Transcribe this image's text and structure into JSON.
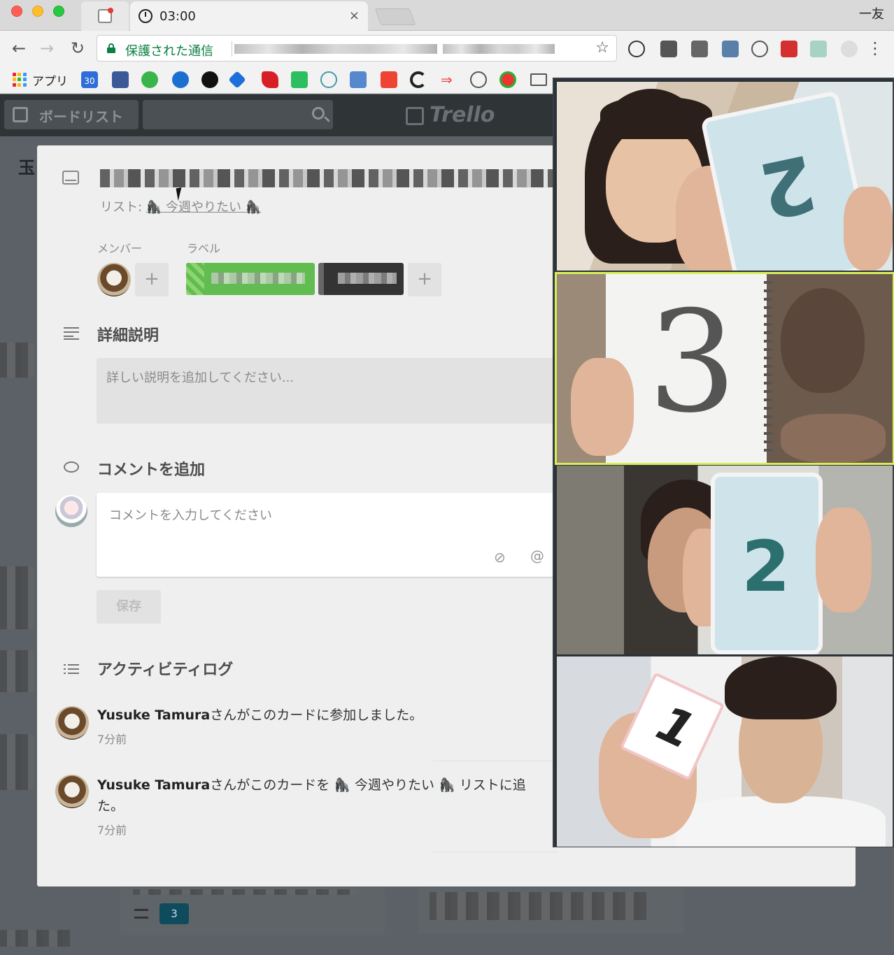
{
  "browser": {
    "active_tab_title": "03:00",
    "tab_close": "×",
    "profile_name": "一友",
    "secure_label": "保護された通信",
    "apps_label": "アプリ",
    "calendar_badge": "30"
  },
  "trello": {
    "boards_button": "ボードリスト",
    "logo_text": "Trello",
    "board_title_char": "玉",
    "background_badge_count": "3"
  },
  "card": {
    "in_list_prefix": "リスト:",
    "list_name": "🦍 今週やりたい 🦍",
    "members_label": "メンバー",
    "labels_label": "ラベル",
    "add_symbol": "+",
    "description_title": "詳細説明",
    "description_placeholder": "詳しい説明を追加してください...",
    "comment_title": "コメントを追加",
    "comment_placeholder": "コメントを入力してください",
    "attach_symbol": "⊘",
    "mention_symbol": "@",
    "save_label": "保存",
    "activity_title": "アクティビティログ",
    "activity": [
      {
        "user": "Yusuke Tamura",
        "text": "さんがこのカードに参加しました。",
        "time": "7分前"
      },
      {
        "user": "Yusuke Tamura",
        "text": "さんがこのカードを 🦍 今週やりたい 🦍  リストに追",
        "text2": "た。",
        "time": "7分前"
      }
    ]
  },
  "video_call": {
    "tiles": [
      {
        "digit": "2"
      },
      {
        "digit": "3"
      },
      {
        "digit": "2"
      },
      {
        "digit": "1"
      }
    ],
    "highlight_color": "#d7ee5a"
  }
}
